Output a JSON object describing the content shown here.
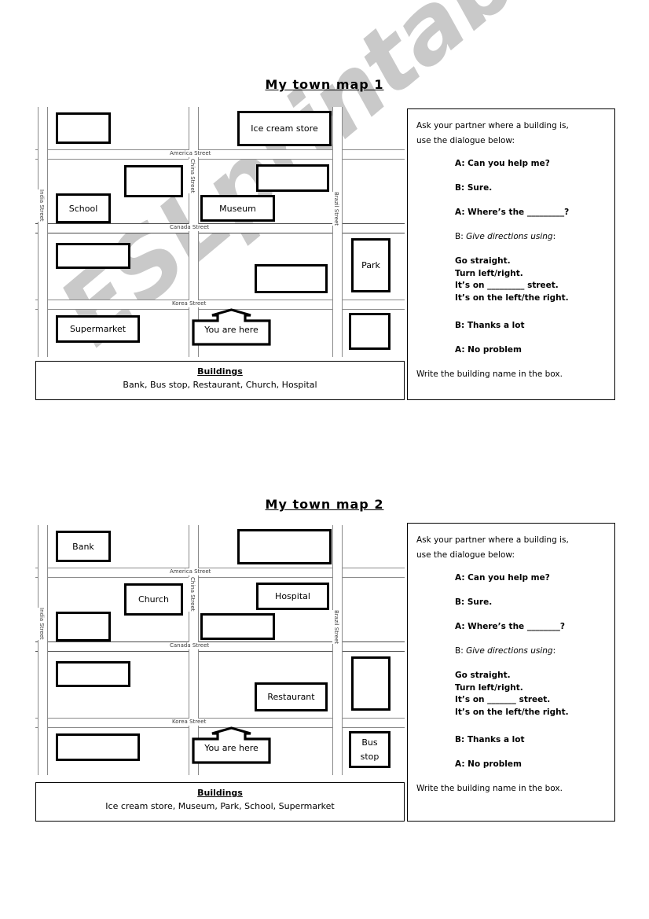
{
  "watermark": {
    "text": "ESLprintables.com"
  },
  "sections": [
    {
      "title": "My town map 1",
      "map": {
        "streets_h": [
          {
            "label": "America Street"
          },
          {
            "label": "Canada Street"
          },
          {
            "label": "Korea Street"
          }
        ],
        "streets_v": [
          {
            "label": "India Street"
          },
          {
            "label": "China Street"
          },
          {
            "label": "Brazil Street"
          }
        ],
        "buildings": [
          {
            "label": ""
          },
          {
            "label": "Ice cream store"
          },
          {
            "label": ""
          },
          {
            "label": ""
          },
          {
            "label": "School"
          },
          {
            "label": "Museum"
          },
          {
            "label": ""
          },
          {
            "label": ""
          },
          {
            "label": "Park"
          },
          {
            "label": "Supermarket"
          },
          {
            "label": ""
          }
        ],
        "you_are_here": "You are here"
      },
      "word_bank": {
        "heading": "Buildings",
        "items": "Bank, Bus stop, Restaurant, Church, Hospital"
      },
      "dialogue": {
        "intro_line1": "Ask your partner where a building is,",
        "intro_line2": "use the dialogue below:",
        "line_a1": "A: Can you help me?",
        "line_b1": "B: Sure.",
        "line_a2": "A: Where’s the _________?",
        "line_b2_prefix": "B: ",
        "line_b2_italic": "Give directions using",
        "line_b2_suffix": ":",
        "directions": [
          "Go straight.",
          "Turn left/right.",
          "It’s on _________ street.",
          "It’s on the left/the right."
        ],
        "line_b3": "B: Thanks a lot",
        "line_a3": "A: No problem",
        "footer": "Write the building name in the box."
      }
    },
    {
      "title": "My town  map 2",
      "map": {
        "streets_h": [
          {
            "label": "America Street"
          },
          {
            "label": "Canada Street"
          },
          {
            "label": "Korea Street"
          }
        ],
        "streets_v": [
          {
            "label": "India Street"
          },
          {
            "label": "China Street"
          },
          {
            "label": "Brazil Street"
          }
        ],
        "buildings": [
          {
            "label": "Bank"
          },
          {
            "label": ""
          },
          {
            "label": "Church"
          },
          {
            "label": "Hospital"
          },
          {
            "label": ""
          },
          {
            "label": ""
          },
          {
            "label": ""
          },
          {
            "label": "Restaurant"
          },
          {
            "label": ""
          },
          {
            "label": ""
          },
          {
            "label": "Bus stop"
          }
        ],
        "you_are_here": "You are here"
      },
      "word_bank": {
        "heading": "Buildings",
        "items": "Ice cream store, Museum, Park, School, Supermarket"
      },
      "dialogue": {
        "intro_line1": "Ask your partner where a building is,",
        "intro_line2": "use the dialogue below:",
        "line_a1": "A: Can you help me?",
        "line_b1": "B: Sure.",
        "line_a2": "A: Where’s the ________?",
        "line_b2_prefix": "B: ",
        "line_b2_italic": "Give directions using",
        "line_b2_suffix": ":",
        "directions": [
          "Go straight.",
          "Turn left/right.",
          "It’s on _______ street.",
          "It’s on the left/the right."
        ],
        "line_b3": "B: Thanks a lot",
        "line_a3": "A: No problem",
        "footer": "Write the building name in the box."
      }
    }
  ]
}
